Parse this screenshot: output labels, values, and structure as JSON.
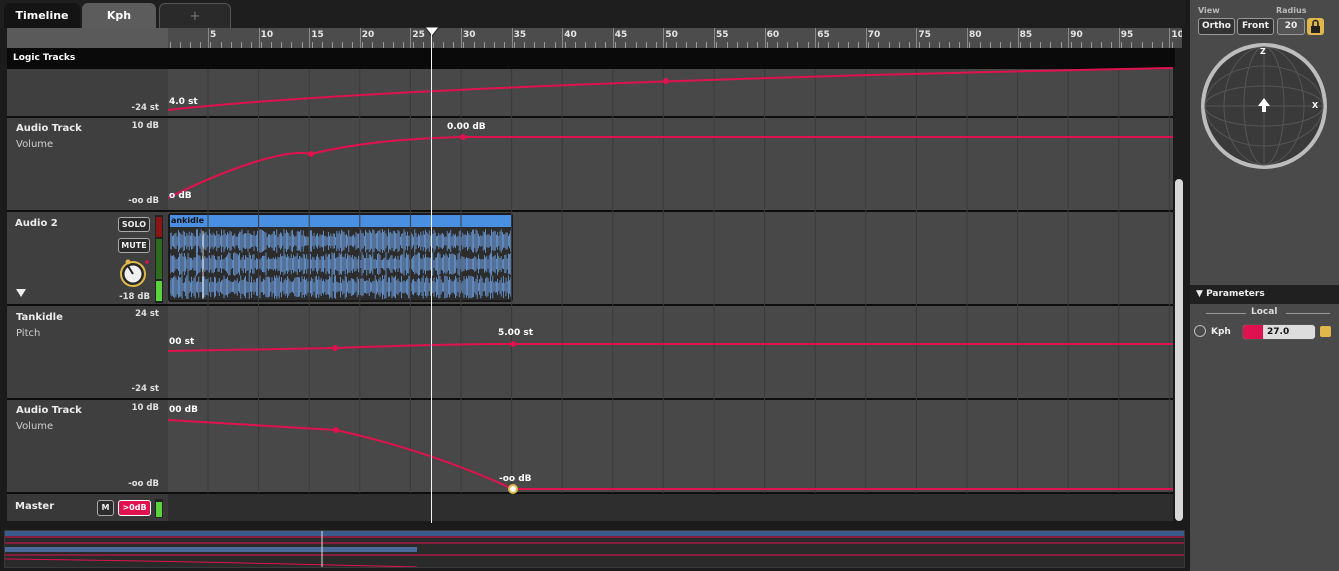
{
  "tabs": {
    "timeline": "Timeline",
    "kph": "Kph",
    "add": "+"
  },
  "ruler": {
    "ticks": [
      "5",
      "10",
      "15",
      "20",
      "25",
      "30",
      "35",
      "40",
      "45",
      "50",
      "55",
      "60",
      "65",
      "70",
      "75",
      "80",
      "85",
      "90",
      "95",
      "10"
    ]
  },
  "logic_header": "Logic Tracks",
  "tracks": [
    {
      "range_low": "-24 st",
      "point_value": "4.0 st"
    },
    {
      "name": "Audio Track",
      "sub": "Volume",
      "range_high": "10 dB",
      "range_low": "-oo dB",
      "start_value": "o dB",
      "point_value": "0.00 dB"
    },
    {
      "name": "Audio 2",
      "solo": "SOLO",
      "mute": "MUTE",
      "gain": "-18 dB",
      "clip_title": "ankidle"
    },
    {
      "name": "Tankidle",
      "sub": "Pitch",
      "range_high": "24 st",
      "range_low": "-24 st",
      "start_value": "00 st",
      "point_value": "5.00 st"
    },
    {
      "name": "Audio Track",
      "sub": "Volume",
      "range_high": "10 dB",
      "range_low": "-oo dB",
      "start_value": "00 dB",
      "point_value": "-oo dB"
    }
  ],
  "master": {
    "name": "Master",
    "mute": "M",
    "gain": ">0dB"
  },
  "view_panel": {
    "view_label": "View",
    "radius_label": "Radius",
    "ortho": "Ortho",
    "front": "Front",
    "radius_value": "20",
    "axis_z": "Z",
    "axis_x": "X"
  },
  "parameters": {
    "header": "Parameters",
    "local_label": "Local",
    "param_name": "Kph",
    "param_value": "27.0"
  },
  "colors": {
    "automation": "#e0114f",
    "clip": "#4a90e2",
    "accent": "#e0b84a"
  },
  "icons": {
    "lock": "lock-icon",
    "triangle": "triangle-down-icon",
    "knob": "knob-icon"
  }
}
